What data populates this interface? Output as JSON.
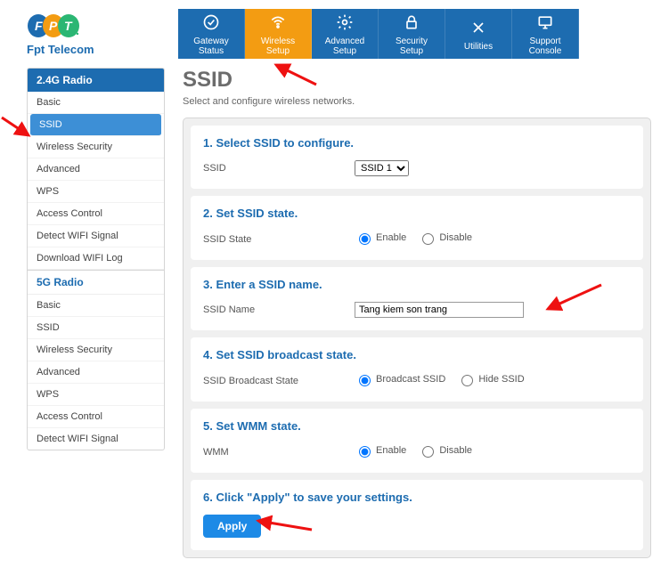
{
  "brand": {
    "name": "Fpt Telecom"
  },
  "nav": {
    "items": [
      {
        "label": "Gateway\nStatus"
      },
      {
        "label": "Wireless\nSetup"
      },
      {
        "label": "Advanced\nSetup"
      },
      {
        "label": "Security\nSetup"
      },
      {
        "label": "Utilities"
      },
      {
        "label": "Support\nConsole"
      }
    ]
  },
  "sidebar": {
    "g24": {
      "title": "2.4G Radio",
      "items": [
        "Basic",
        "SSID",
        "Wireless Security",
        "Advanced",
        "WPS",
        "Access Control",
        "Detect WIFI Signal",
        "Download WIFI Log"
      ]
    },
    "g5": {
      "title": "5G Radio",
      "items": [
        "Basic",
        "SSID",
        "Wireless Security",
        "Advanced",
        "WPS",
        "Access Control",
        "Detect WIFI Signal"
      ]
    }
  },
  "page": {
    "title": "SSID",
    "subtitle": "Select and configure wireless networks."
  },
  "sections": {
    "s1": {
      "title": "1. Select SSID to configure.",
      "label": "SSID",
      "options": [
        "SSID 1"
      ],
      "value": "SSID 1"
    },
    "s2": {
      "title": "2. Set SSID state.",
      "label": "SSID State",
      "opt1": "Enable",
      "opt2": "Disable",
      "selected": "Enable"
    },
    "s3": {
      "title": "3. Enter a SSID name.",
      "label": "SSID Name",
      "value": "Tang kiem son trang"
    },
    "s4": {
      "title": "4. Set SSID broadcast state.",
      "label": "SSID Broadcast State",
      "opt1": "Broadcast SSID",
      "opt2": "Hide SSID",
      "selected": "Broadcast SSID"
    },
    "s5": {
      "title": "5. Set WMM state.",
      "label": "WMM",
      "opt1": "Enable",
      "opt2": "Disable",
      "selected": "Enable"
    },
    "s6": {
      "title": "6. Click \"Apply\" to save your settings.",
      "button": "Apply"
    }
  }
}
